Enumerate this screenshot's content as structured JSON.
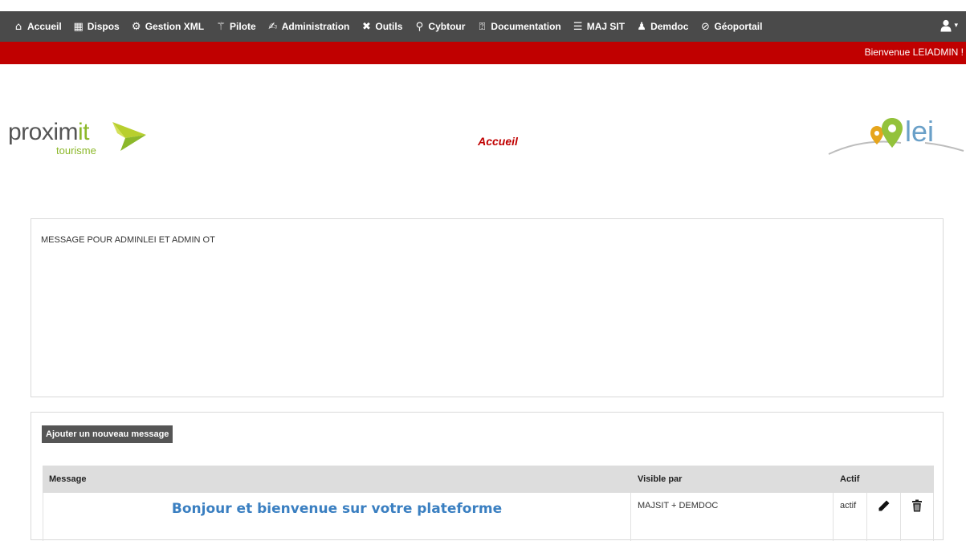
{
  "navbar": {
    "items": [
      {
        "label": "Accueil",
        "icon": "home-icon",
        "glyph": "⌂"
      },
      {
        "label": "Dispos",
        "icon": "calendar-icon",
        "glyph": "▦"
      },
      {
        "label": "Gestion XML",
        "icon": "gear-icon",
        "glyph": "⚙"
      },
      {
        "label": "Pilote",
        "icon": "magic-wand-icon",
        "glyph": "⚚"
      },
      {
        "label": "Administration",
        "icon": "admin-icon",
        "glyph": "✍"
      },
      {
        "label": "Outils",
        "icon": "tools-icon",
        "glyph": "✖"
      },
      {
        "label": "Cybtour",
        "icon": "search-icon",
        "glyph": "⚲"
      },
      {
        "label": "Documentation",
        "icon": "question-icon",
        "glyph": "⍰"
      },
      {
        "label": "MAJ SIT",
        "icon": "list-icon",
        "glyph": "☰"
      },
      {
        "label": "Demdoc",
        "icon": "users-icon",
        "glyph": "♟"
      },
      {
        "label": "Géoportail",
        "icon": "compass-icon",
        "glyph": "⊘"
      }
    ],
    "user_icon": "user-icon"
  },
  "banner": {
    "welcome": "Bienvenue LEIADMIN !",
    "color": "#c00000"
  },
  "header": {
    "logo_left": {
      "brand_main": "proxim",
      "brand_accent": "it",
      "sub": "tourisme"
    },
    "title": "Accueil",
    "logo_right": {
      "text": "lei"
    }
  },
  "message_panel": {
    "text": "MESSAGE POUR  ADMINLEI ET ADMIN OT"
  },
  "list_panel": {
    "add_button_label": "Ajouter un nouveau message",
    "columns": {
      "message": "Message",
      "visible_par": "Visible par",
      "actif": "Actif"
    },
    "rows": [
      {
        "message": "Bonjour et bienvenue sur votre plateforme",
        "visible_par": "MAJSIT + DEMDOC",
        "actif": "actif"
      }
    ]
  }
}
